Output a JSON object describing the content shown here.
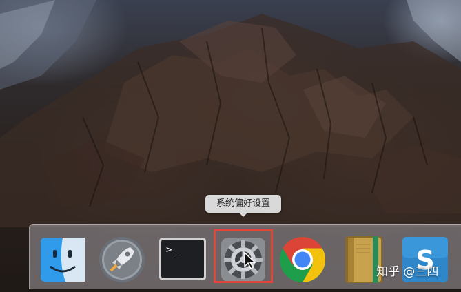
{
  "tooltip": {
    "label": "系统偏好设置"
  },
  "dock": {
    "items": [
      {
        "name": "finder",
        "icon": "finder-icon"
      },
      {
        "name": "launchpad",
        "icon": "rocket-icon"
      },
      {
        "name": "terminal",
        "icon": "terminal-icon",
        "prompt": ">_"
      },
      {
        "name": "system-preferences",
        "icon": "gear-icon"
      },
      {
        "name": "chrome",
        "icon": "chrome-icon"
      },
      {
        "name": "notes-book",
        "icon": "book-icon"
      },
      {
        "name": "snagit",
        "icon": "snagit-icon",
        "letter": "S"
      }
    ]
  },
  "watermark": {
    "text": "知乎 @三四"
  },
  "colors": {
    "highlight": "#e0473a",
    "tooltip_bg": "#d9d9d9"
  }
}
